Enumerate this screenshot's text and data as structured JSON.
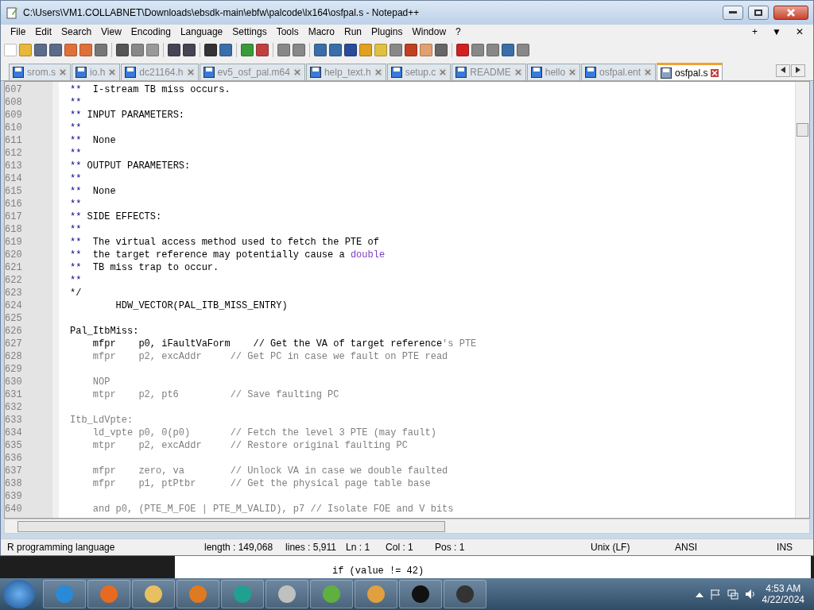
{
  "window": {
    "title": "C:\\Users\\VM1.COLLABNET\\Downloads\\ebsdk-main\\ebfw\\palcode\\lx164\\osfpal.s - Notepad++"
  },
  "menu": [
    "File",
    "Edit",
    "Search",
    "View",
    "Encoding",
    "Language",
    "Settings",
    "Tools",
    "Macro",
    "Run",
    "Plugins",
    "Window",
    "?"
  ],
  "menu_right": [
    "+",
    "▼",
    "✕"
  ],
  "tabs": [
    {
      "label": "srom.s",
      "selected": false
    },
    {
      "label": "io.h",
      "selected": false
    },
    {
      "label": "dc21164.h",
      "selected": false
    },
    {
      "label": "ev5_osf_pal.m64",
      "selected": false
    },
    {
      "label": "help_text.h",
      "selected": false
    },
    {
      "label": "setup.c",
      "selected": false
    },
    {
      "label": "README",
      "selected": false
    },
    {
      "label": "hello",
      "selected": false
    },
    {
      "label": "osfpal.ent",
      "selected": false
    },
    {
      "label": "osfpal.s",
      "selected": true
    }
  ],
  "editor": {
    "lines": [
      {
        "number": "607",
        "parts": [
          {
            "kind": "star",
            "text": "**"
          },
          {
            "kind": "text",
            "text": "  I-stream TB miss occurs."
          }
        ]
      },
      {
        "number": "608",
        "parts": [
          {
            "kind": "star",
            "text": "**"
          }
        ]
      },
      {
        "number": "609",
        "parts": [
          {
            "kind": "star",
            "text": "**"
          },
          {
            "kind": "text",
            "text": " INPUT PARAMETERS:"
          }
        ]
      },
      {
        "number": "610",
        "parts": [
          {
            "kind": "star",
            "text": "**"
          }
        ]
      },
      {
        "number": "611",
        "parts": [
          {
            "kind": "star",
            "text": "**"
          },
          {
            "kind": "text",
            "text": "  None"
          }
        ]
      },
      {
        "number": "612",
        "parts": [
          {
            "kind": "star",
            "text": "**"
          }
        ]
      },
      {
        "number": "613",
        "parts": [
          {
            "kind": "star",
            "text": "**"
          },
          {
            "kind": "text",
            "text": " OUTPUT PARAMETERS:"
          }
        ]
      },
      {
        "number": "614",
        "parts": [
          {
            "kind": "star",
            "text": "**"
          }
        ]
      },
      {
        "number": "615",
        "parts": [
          {
            "kind": "star",
            "text": "**"
          },
          {
            "kind": "text",
            "text": "  None"
          }
        ]
      },
      {
        "number": "616",
        "parts": [
          {
            "kind": "star",
            "text": "**"
          }
        ]
      },
      {
        "number": "617",
        "parts": [
          {
            "kind": "star",
            "text": "**"
          },
          {
            "kind": "text",
            "text": " SIDE EFFECTS:"
          }
        ]
      },
      {
        "number": "618",
        "parts": [
          {
            "kind": "star",
            "text": "**"
          }
        ]
      },
      {
        "number": "619",
        "parts": [
          {
            "kind": "star",
            "text": "**"
          },
          {
            "kind": "text",
            "text": "  The virtual access method used to fetch the PTE of"
          }
        ]
      },
      {
        "number": "620",
        "parts": [
          {
            "kind": "star",
            "text": "**"
          },
          {
            "kind": "text",
            "text": "  the target reference may potentially cause a "
          },
          {
            "kind": "keyword",
            "text": "double"
          }
        ]
      },
      {
        "number": "621",
        "parts": [
          {
            "kind": "star",
            "text": "**"
          },
          {
            "kind": "text",
            "text": "  TB miss trap to occur."
          }
        ]
      },
      {
        "number": "622",
        "parts": [
          {
            "kind": "star",
            "text": "**"
          }
        ]
      },
      {
        "number": "623",
        "parts": [
          {
            "kind": "text",
            "text": "*/"
          }
        ]
      },
      {
        "number": "624",
        "parts": [
          {
            "kind": "text",
            "text": "        HDW_VECTOR(PAL_ITB_MISS_ENTRY)"
          }
        ]
      },
      {
        "number": "625"
      },
      {
        "number": "626",
        "parts": [
          {
            "kind": "text",
            "text": "Pal_ItbMiss:"
          }
        ]
      },
      {
        "number": "627",
        "parts": [
          {
            "kind": "text",
            "text": "    mfpr    p0, iFaultVaForm    // Get the VA of target reference"
          },
          {
            "kind": "dim",
            "text": "'s PTE"
          }
        ]
      },
      {
        "number": "628",
        "parts": [
          {
            "kind": "dim",
            "text": "    mfpr    p2, excAddr     // Get PC in case we fault on PTE read"
          }
        ]
      },
      {
        "number": "629"
      },
      {
        "number": "630",
        "parts": [
          {
            "kind": "dim",
            "text": "    NOP"
          }
        ]
      },
      {
        "number": "631",
        "parts": [
          {
            "kind": "dim",
            "text": "    mtpr    p2, pt6         // Save faulting PC"
          }
        ]
      },
      {
        "number": "632"
      },
      {
        "number": "633",
        "parts": [
          {
            "kind": "dim",
            "text": "Itb_LdVpte:"
          }
        ]
      },
      {
        "number": "634",
        "parts": [
          {
            "kind": "dim",
            "text": "    ld_vpte p0, 0(p0)       // Fetch the level 3 PTE (may fault)"
          }
        ]
      },
      {
        "number": "635",
        "parts": [
          {
            "kind": "dim",
            "text": "    mtpr    p2, excAddr     // Restore original faulting PC"
          }
        ]
      },
      {
        "number": "636"
      },
      {
        "number": "637",
        "parts": [
          {
            "kind": "dim",
            "text": "    mfpr    zero, va        // Unlock VA in case we double faulted"
          }
        ]
      },
      {
        "number": "638",
        "parts": [
          {
            "kind": "dim",
            "text": "    mfpr    p1, ptPtbr      // Get the physical page table base"
          }
        ]
      },
      {
        "number": "639"
      },
      {
        "number": "640",
        "parts": [
          {
            "kind": "dim",
            "text": "    and p0, (PTE_M_FOE | PTE_M_VALID), p7 // Isolate FOE and V bits"
          }
        ]
      }
    ]
  },
  "status_bar": [
    "R programming language",
    "length : 149,068",
    "lines : 5,911",
    "Ln : 1",
    "Col : 1",
    "Pos : 1",
    "Unix (LF)",
    "ANSI",
    "INS"
  ],
  "background_window": {
    "line": "if (value != 42)"
  },
  "taskbar": {
    "time": "4:53 AM",
    "date": "4/22/2024"
  }
}
